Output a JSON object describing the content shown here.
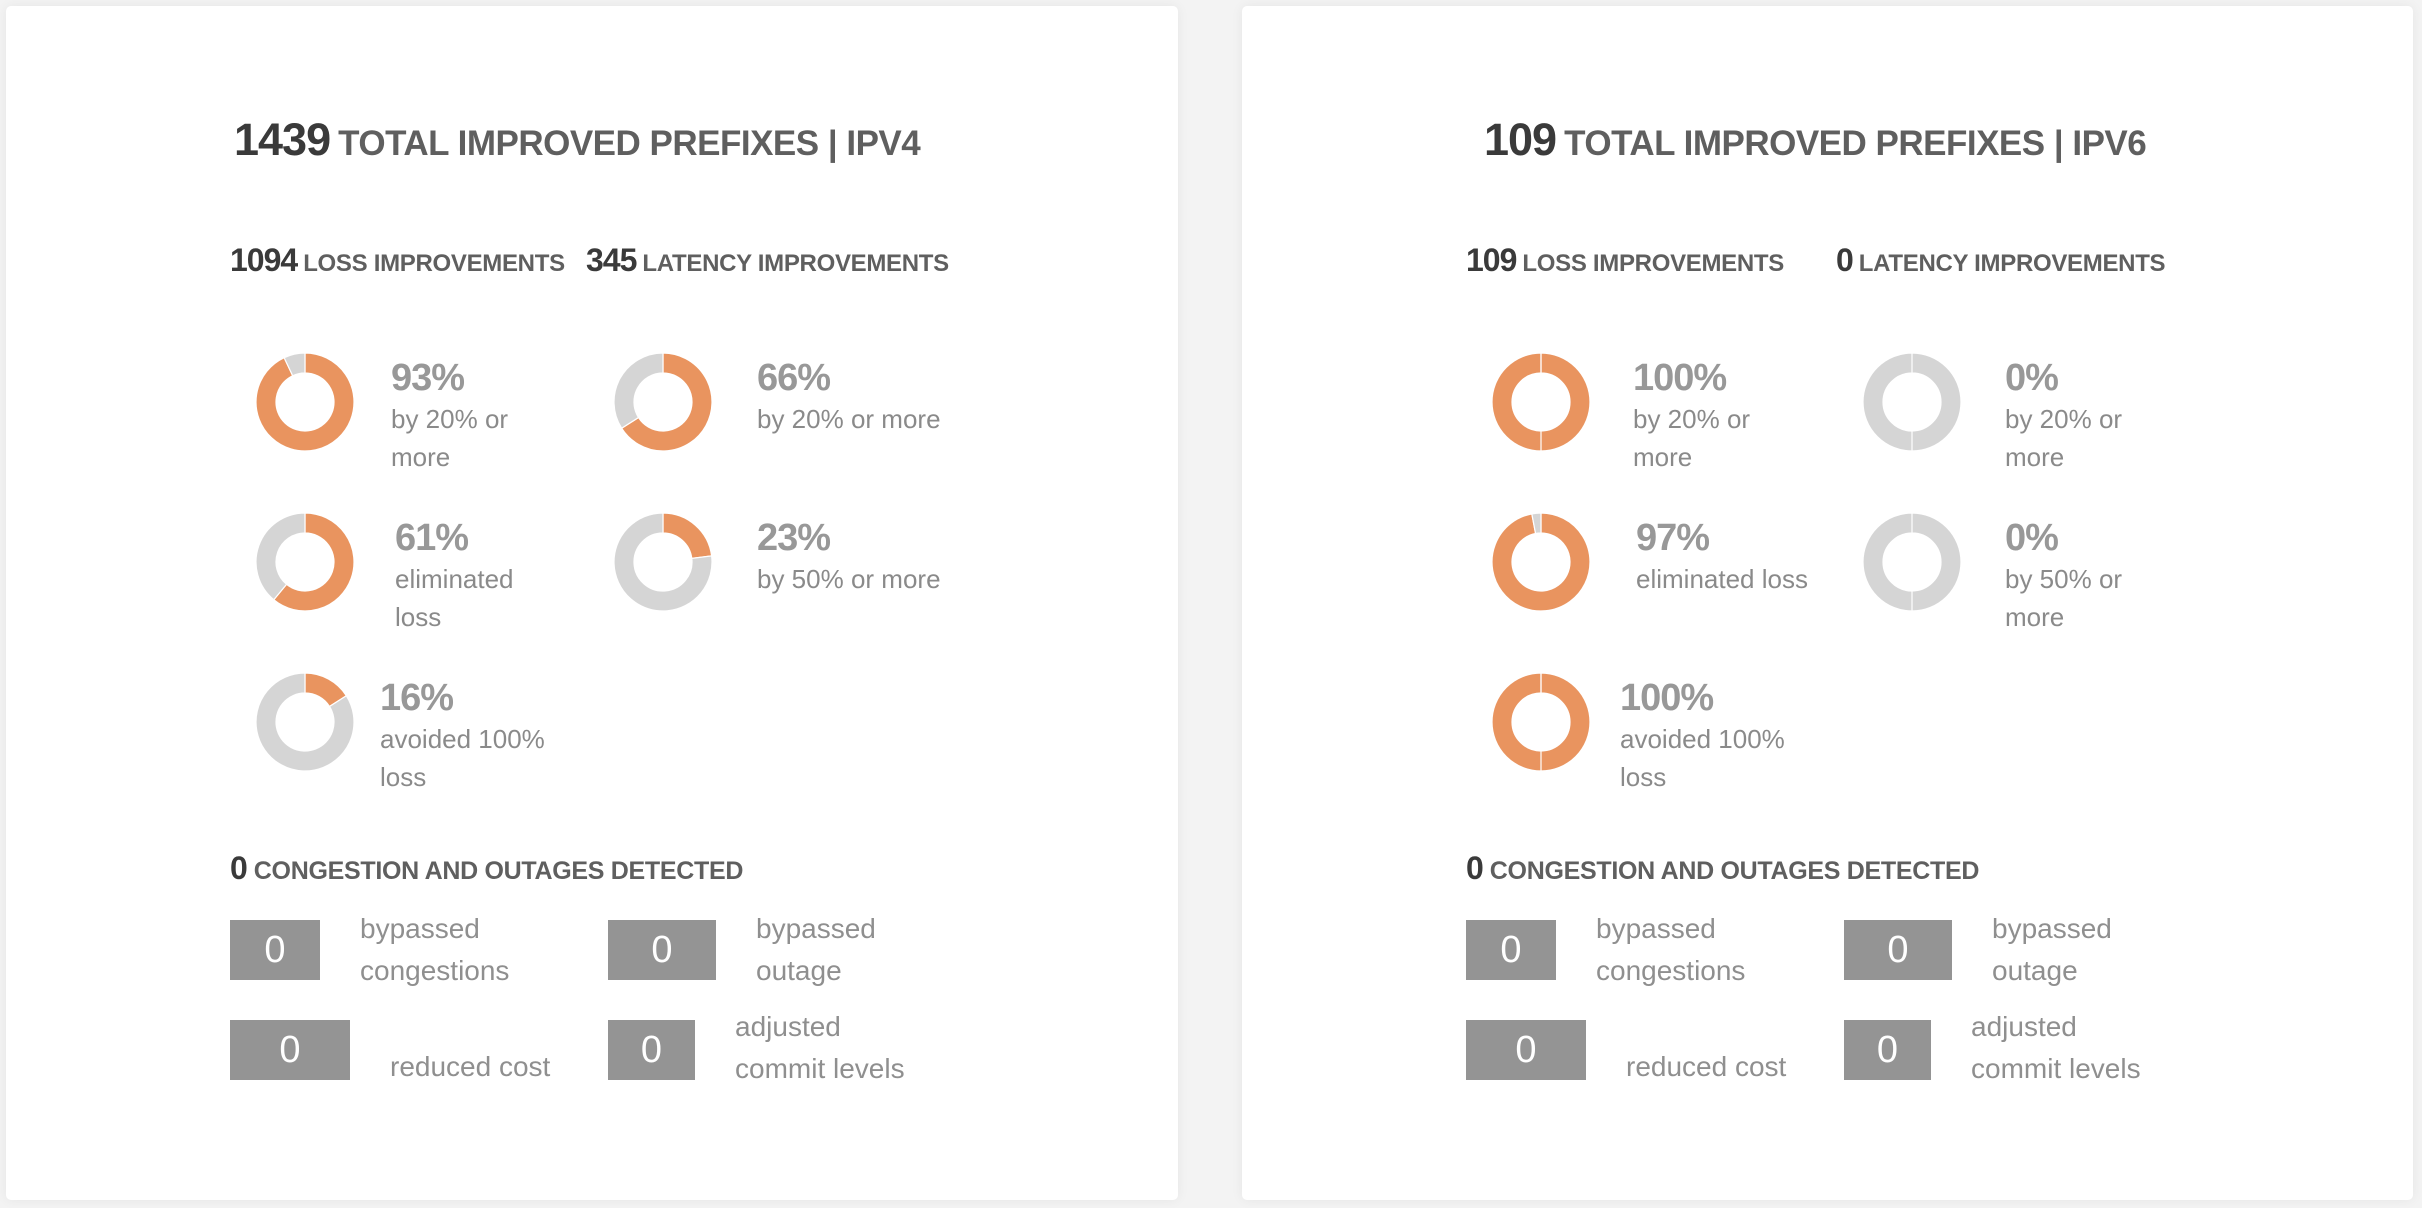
{
  "colors": {
    "accent": "#e9945f",
    "track": "#d5d5d5",
    "box": "#949494"
  },
  "panels": [
    {
      "title": {
        "count": "1439",
        "label": "TOTAL IMPROVED PREFIXES | IPV4"
      },
      "loss": {
        "count": "1094",
        "label": "LOSS IMPROVEMENTS"
      },
      "latency": {
        "count": "345",
        "label": "LATENCY IMPROVEMENTS"
      },
      "loss_stats": [
        {
          "percent": 93,
          "pct_label": "93%",
          "desc": "by 20% or more"
        },
        {
          "percent": 61,
          "pct_label": "61%",
          "desc": "eliminated loss"
        },
        {
          "percent": 16,
          "pct_label": "16%",
          "desc": "avoided 100% loss"
        }
      ],
      "latency_stats": [
        {
          "percent": 66,
          "pct_label": "66%",
          "desc": "by 20% or more"
        },
        {
          "percent": 23,
          "pct_label": "23%",
          "desc": "by 50% or more"
        }
      ],
      "congestion": {
        "count": "0",
        "label": "CONGESTION AND OUTAGES DETECTED"
      },
      "counters": [
        {
          "value": "0",
          "label": "bypassed congestions"
        },
        {
          "value": "0",
          "label": "bypassed outage"
        },
        {
          "value": "0",
          "label": "reduced cost"
        },
        {
          "value": "0",
          "label": "adjusted commit levels"
        }
      ]
    },
    {
      "title": {
        "count": "109",
        "label": "TOTAL IMPROVED PREFIXES | IPV6"
      },
      "loss": {
        "count": "109",
        "label": "LOSS IMPROVEMENTS"
      },
      "latency": {
        "count": "0",
        "label": "LATENCY IMPROVEMENTS"
      },
      "loss_stats": [
        {
          "percent": 100,
          "pct_label": "100%",
          "desc": "by 20% or more"
        },
        {
          "percent": 97,
          "pct_label": "97%",
          "desc": "eliminated loss"
        },
        {
          "percent": 100,
          "pct_label": "100%",
          "desc": "avoided 100% loss"
        }
      ],
      "latency_stats": [
        {
          "percent": 0,
          "pct_label": "0%",
          "desc": "by 20% or more"
        },
        {
          "percent": 0,
          "pct_label": "0%",
          "desc": "by 50% or more"
        }
      ],
      "congestion": {
        "count": "0",
        "label": "CONGESTION AND OUTAGES DETECTED"
      },
      "counters": [
        {
          "value": "0",
          "label": "bypassed congestions"
        },
        {
          "value": "0",
          "label": "bypassed outage"
        },
        {
          "value": "0",
          "label": "reduced cost"
        },
        {
          "value": "0",
          "label": "adjusted commit levels"
        }
      ]
    }
  ]
}
